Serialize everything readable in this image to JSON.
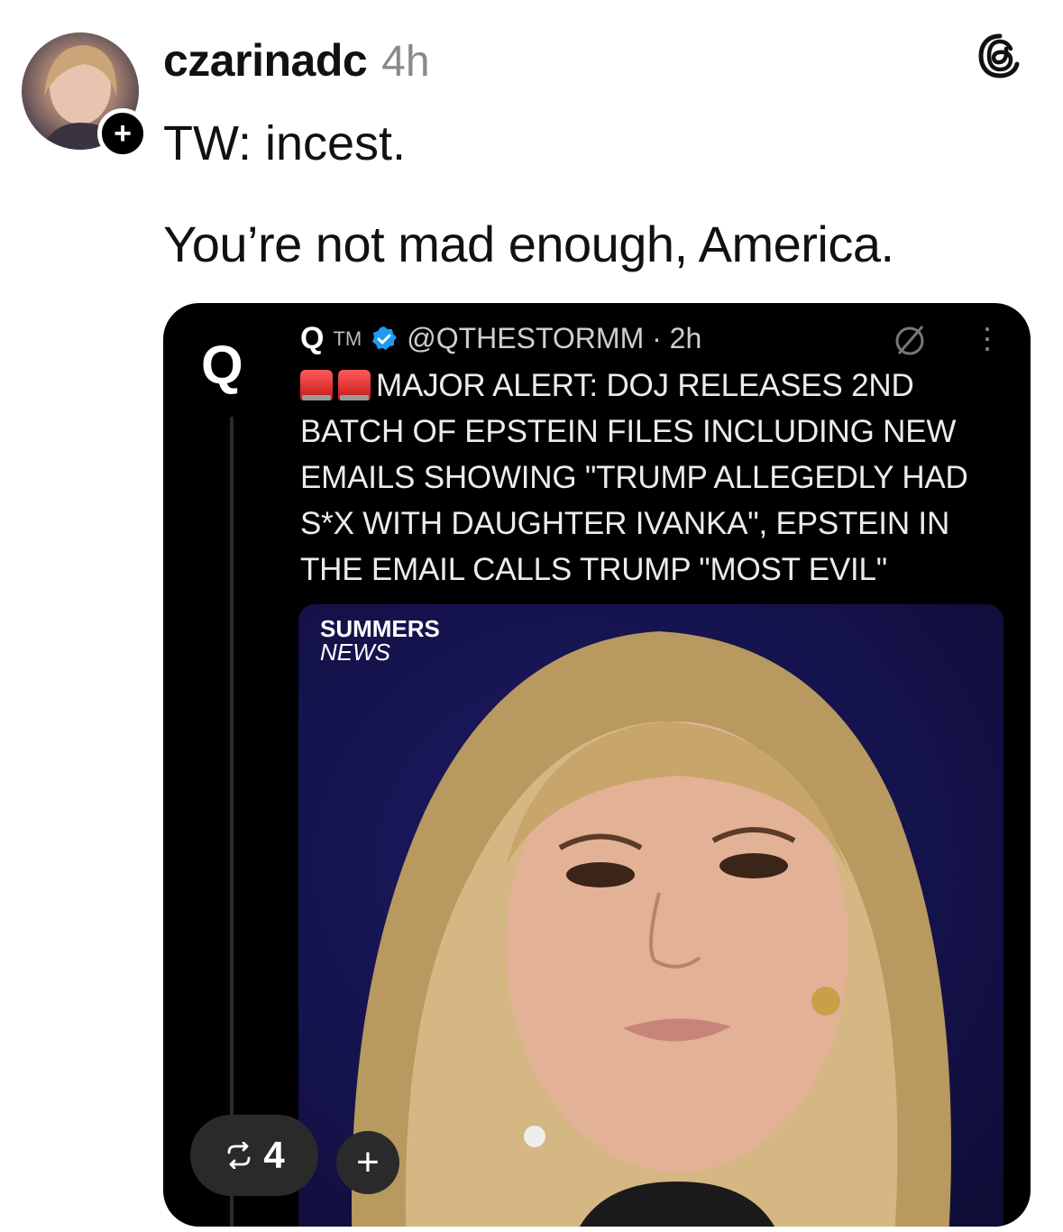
{
  "post": {
    "username": "czarinadc",
    "time": "4h",
    "line1": "TW: incest.",
    "line2": "You’re not mad enough, America."
  },
  "embed": {
    "logo_letter": "Q",
    "author_name": "Q",
    "author_suffix": "TM",
    "handle_time": "@QTHESTORMM · 2h",
    "body": "MAJOR ALERT: DOJ RELEASES 2ND BATCH OF EPSTEIN FILES INCLUDING NEW EMAILS SHOWING \"TRUMP ALLEGEDLY HAD S*X WITH DAUGHTER IVANKA\", EPSTEIN IN THE EMAIL CALLS TRUMP \"MOST EVIL\"",
    "photo_brand_top": "SUMMERS",
    "photo_brand_bottom": "NEWS"
  },
  "actions": {
    "repost_count": "4",
    "add_symbol": "+"
  },
  "icons": {
    "follow": "plus-icon",
    "app": "threads-logo-icon",
    "verified": "verified-badge-icon",
    "repost": "repost-icon"
  }
}
